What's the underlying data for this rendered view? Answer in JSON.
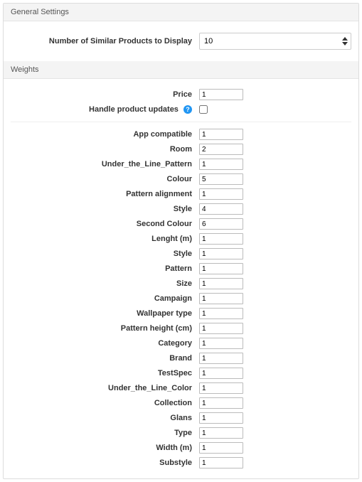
{
  "general": {
    "title": "General Settings",
    "displayCount": {
      "label": "Number of Similar Products to Display",
      "value": "10"
    }
  },
  "weights": {
    "title": "Weights",
    "price": {
      "label": "Price",
      "value": "1"
    },
    "handleUpdates": {
      "label": "Handle product updates",
      "checked": false
    },
    "attributes": [
      {
        "label": "App compatible",
        "value": "1"
      },
      {
        "label": "Room",
        "value": "2"
      },
      {
        "label": "Under_the_Line_Pattern",
        "value": "1"
      },
      {
        "label": "Colour",
        "value": "5"
      },
      {
        "label": "Pattern alignment",
        "value": "1"
      },
      {
        "label": "Style",
        "value": "4"
      },
      {
        "label": "Second Colour",
        "value": "6"
      },
      {
        "label": "Lenght (m)",
        "value": "1"
      },
      {
        "label": "Style",
        "value": "1"
      },
      {
        "label": "Pattern",
        "value": "1"
      },
      {
        "label": "Size",
        "value": "1"
      },
      {
        "label": "Campaign",
        "value": "1"
      },
      {
        "label": "Wallpaper type",
        "value": "1"
      },
      {
        "label": "Pattern height (cm)",
        "value": "1"
      },
      {
        "label": "Category",
        "value": "1"
      },
      {
        "label": "Brand",
        "value": "1"
      },
      {
        "label": "TestSpec",
        "value": "1"
      },
      {
        "label": "Under_the_Line_Color",
        "value": "1"
      },
      {
        "label": "Collection",
        "value": "1"
      },
      {
        "label": "Glans",
        "value": "1"
      },
      {
        "label": "Type",
        "value": "1"
      },
      {
        "label": "Width (m)",
        "value": "1"
      },
      {
        "label": "Substyle",
        "value": "1"
      }
    ]
  },
  "helpGlyph": "?"
}
